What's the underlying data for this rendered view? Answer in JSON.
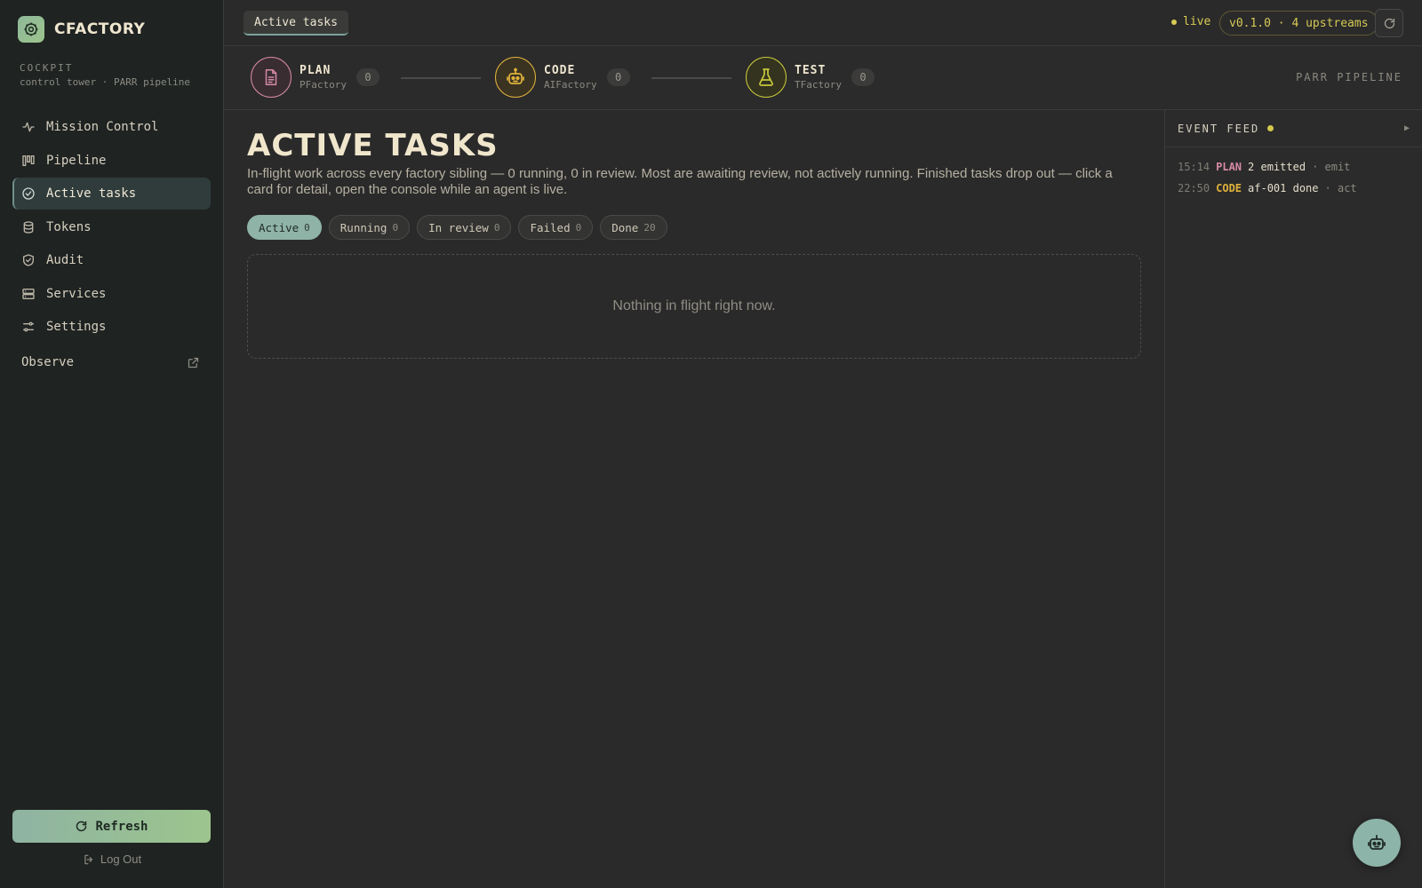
{
  "app": {
    "name": "CFACTORY",
    "section_label": "COCKPIT",
    "section_sub": "control tower · PARR pipeline"
  },
  "sidebar": {
    "items": [
      {
        "label": "Mission Control",
        "icon": "activity-icon"
      },
      {
        "label": "Pipeline",
        "icon": "kanban-icon"
      },
      {
        "label": "Active tasks",
        "icon": "check-circle-icon",
        "active": true
      },
      {
        "label": "Tokens",
        "icon": "database-icon"
      },
      {
        "label": "Audit",
        "icon": "shield-check-icon"
      },
      {
        "label": "Services",
        "icon": "server-icon"
      },
      {
        "label": "Settings",
        "icon": "sliders-icon"
      }
    ],
    "observe_label": "Observe",
    "refresh_label": "Refresh",
    "logout_label": "Log Out"
  },
  "topbar": {
    "breadcrumb": "Active tasks",
    "status": "live",
    "version": "v0.1.0 · 4 upstreams"
  },
  "pipeline": {
    "label": "PARR PIPELINE",
    "stages": [
      {
        "name": "PLAN",
        "factory": "PFactory",
        "count": "0",
        "color": "#d68aa6",
        "icon": "document-icon"
      },
      {
        "name": "CODE",
        "factory": "AIFactory",
        "count": "0",
        "color": "#e0b23c",
        "icon": "robot-icon"
      },
      {
        "name": "TEST",
        "factory": "TFactory",
        "count": "0",
        "color": "#c8c83c",
        "icon": "flask-icon"
      }
    ]
  },
  "main": {
    "title": "ACTIVE TASKS",
    "description": "In-flight work across every factory sibling — 0 running, 0 in review. Most are awaiting review, not actively running. Finished tasks drop out — click a card for detail, open the console while an agent is live.",
    "filters": [
      {
        "label": "Active",
        "count": "0",
        "active": true
      },
      {
        "label": "Running",
        "count": "0"
      },
      {
        "label": "In review",
        "count": "0"
      },
      {
        "label": "Failed",
        "count": "0"
      },
      {
        "label": "Done",
        "count": "20"
      }
    ],
    "empty_message": "Nothing in flight right now."
  },
  "feed": {
    "title": "EVENT FEED",
    "toggle": "▶",
    "events": [
      {
        "time": "15:14",
        "stage": "PLAN",
        "stage_color": "#d68aa6",
        "main": "2 emitted",
        "kind": "· emit"
      },
      {
        "time": "22:50",
        "stage": "CODE",
        "stage_color": "#e0b23c",
        "main": "af-001 done",
        "kind": "· act"
      }
    ]
  },
  "colors": {
    "accent": "#8fb3a6",
    "live": "#d9cc55"
  }
}
